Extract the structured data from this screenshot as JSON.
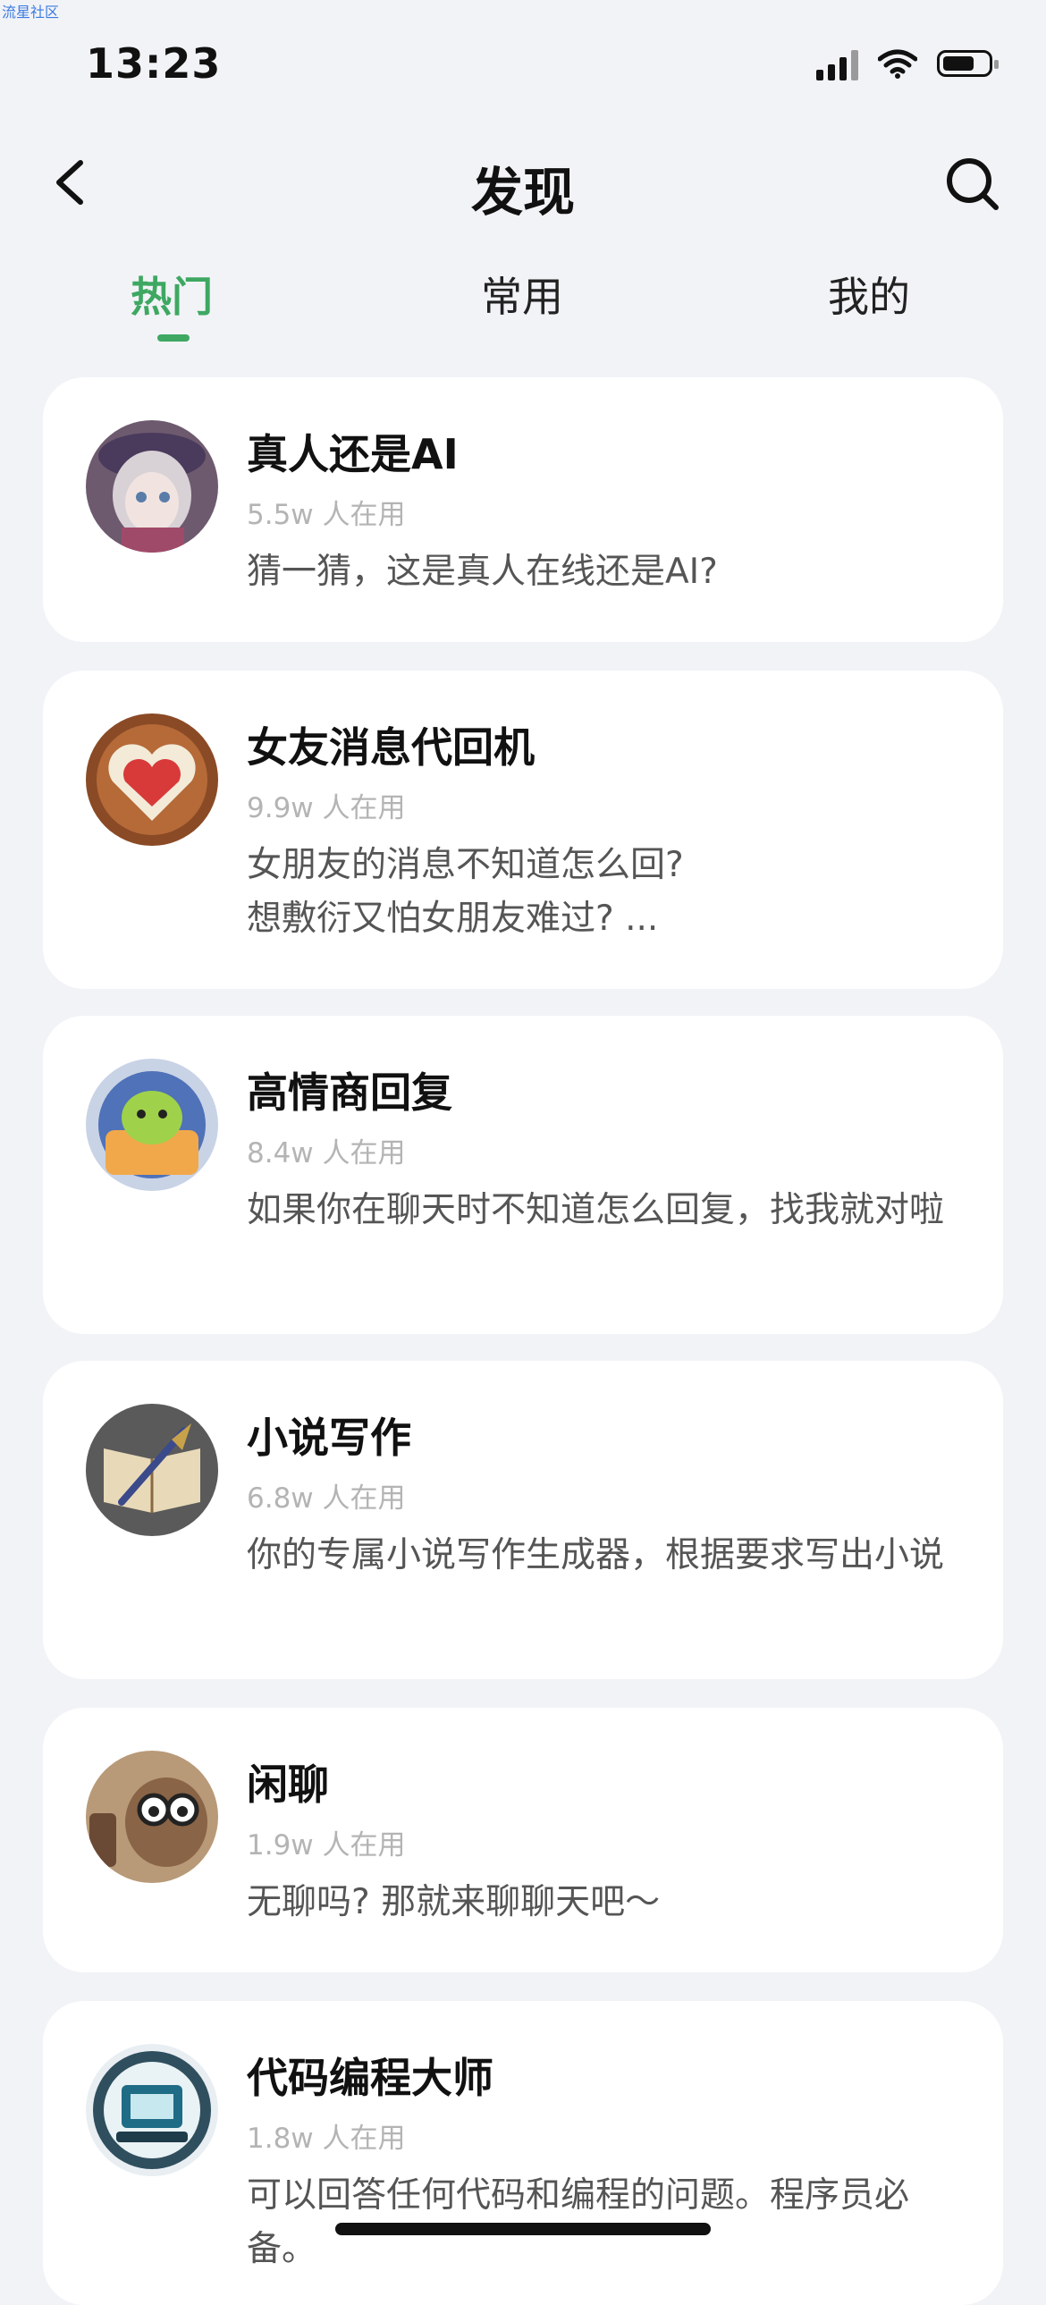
{
  "watermark": "流星社区",
  "status_bar": {
    "time": "13:23"
  },
  "header": {
    "title": "发现"
  },
  "tabs": [
    {
      "label": "热门",
      "active": true
    },
    {
      "label": "常用",
      "active": false
    },
    {
      "label": "我的",
      "active": false
    }
  ],
  "cards": [
    {
      "name": "真人还是AI",
      "users": "5.5w 人在用",
      "desc": "猜一猜，这是真人在线还是AI?"
    },
    {
      "name": "女友消息代回机",
      "users": "9.9w 人在用",
      "desc": "女朋友的消息不知道怎么回?\n想敷衍又怕女朋友难过? ..."
    },
    {
      "name": "高情商回复",
      "users": "8.4w 人在用",
      "desc": "如果你在聊天时不知道怎么回复，找我就对啦"
    },
    {
      "name": "小说写作",
      "users": "6.8w 人在用",
      "desc": "你的专属小说写作生成器，根据要求写出小说"
    },
    {
      "name": "闲聊",
      "users": "1.9w 人在用",
      "desc": "无聊吗? 那就来聊聊天吧～"
    },
    {
      "name": "代码编程大师",
      "users": "1.8w 人在用",
      "desc": "可以回答任何代码和编程的问题。程序员必备。"
    }
  ],
  "colors": {
    "accent": "#3ea862",
    "background": "#f2f3f7"
  },
  "icons": [
    "back-icon",
    "search-icon",
    "signal-icon",
    "wifi-icon",
    "battery-icon"
  ]
}
